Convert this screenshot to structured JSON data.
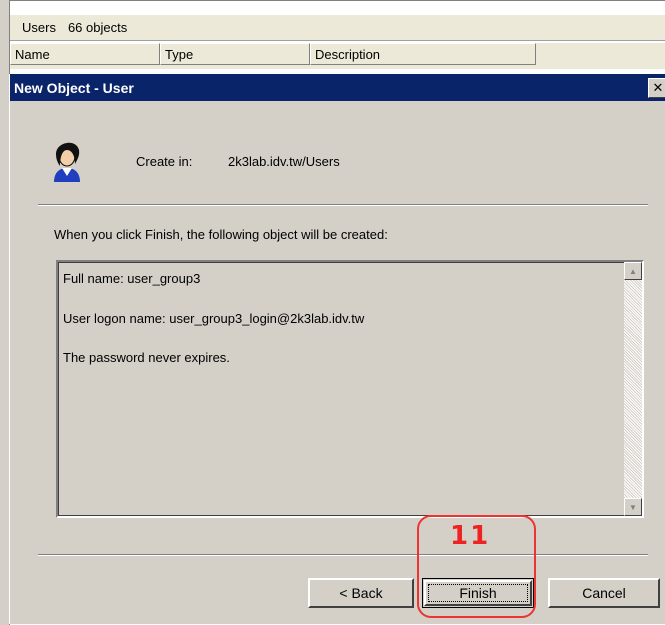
{
  "background": {
    "header_title": "Users",
    "header_count": "66 objects",
    "columns": [
      "Name",
      "Type",
      "Description"
    ]
  },
  "dialog": {
    "title": "New Object - User",
    "close_glyph": "✕",
    "create_in_label": "Create in:",
    "create_in_path": "2k3lab.idv.tw/Users",
    "intro": "When you click Finish, the following object will be created:",
    "summary_lines": [
      "Full name: user_group3",
      "User logon name: user_group3_login@2k3lab.idv.tw",
      "The password never expires."
    ],
    "buttons": {
      "back": "< Back",
      "finish": "Finish",
      "cancel": "Cancel"
    }
  },
  "annotation": {
    "step_number": "11",
    "color": "#e33333"
  },
  "colors": {
    "titlebar": "#0a246a",
    "dialog_face": "#d4d0c8"
  },
  "icons": [
    "user-icon",
    "close-icon",
    "scroll-up-icon",
    "scroll-down-icon"
  ]
}
